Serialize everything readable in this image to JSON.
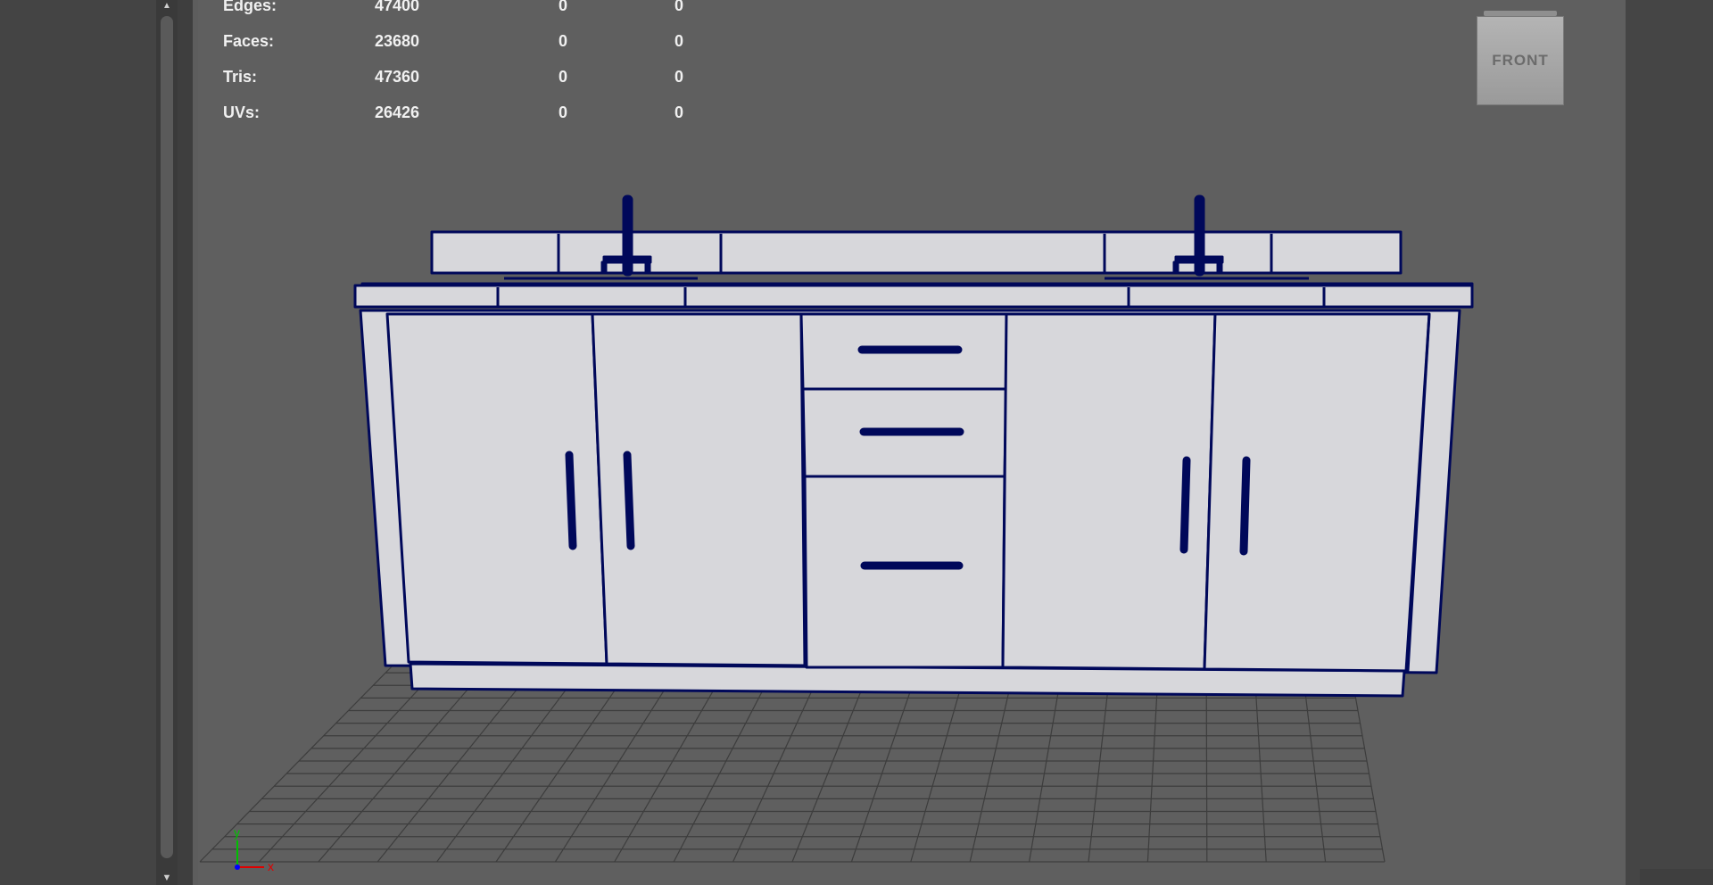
{
  "stats": {
    "rows": [
      {
        "label": "Edges:",
        "values": [
          "47400",
          "0",
          "0"
        ]
      },
      {
        "label": "Faces:",
        "values": [
          "23680",
          "0",
          "0"
        ]
      },
      {
        "label": "Tris:",
        "values": [
          "47360",
          "0",
          "0"
        ]
      },
      {
        "label": "UVs:",
        "values": [
          "26426",
          "0",
          "0"
        ]
      }
    ]
  },
  "view_cube": {
    "label": "FRONT"
  },
  "axis": {
    "y": "y",
    "x": "x"
  },
  "colors": {
    "wireframe": "#00085a",
    "surface": "#d7d7db",
    "grid": "#3d3d3d",
    "axis_x": "#e00000",
    "axis_y": "#00c000",
    "axis_z": "#0000ff"
  },
  "icons": [
    "scroll-up-arrow-icon",
    "scroll-down-arrow-icon",
    "axis-gizmo-icon"
  ]
}
